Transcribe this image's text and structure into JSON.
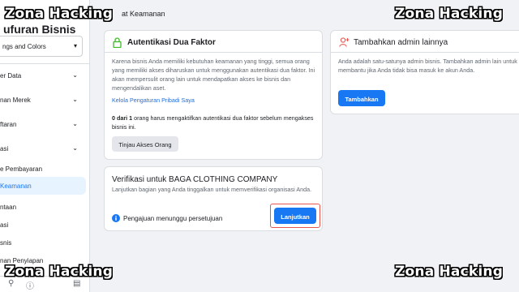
{
  "sidebar": {
    "title": "ufuran Bisnis",
    "selected_business": "ngs and Colors",
    "items": [
      {
        "label": "er Data",
        "chevron": true
      },
      {
        "label": "nan Merek",
        "chevron": true
      },
      {
        "label": "ftaran",
        "chevron": true
      },
      {
        "label": "asi",
        "chevron": true
      },
      {
        "label": "e Pembayaran",
        "chevron": false
      },
      {
        "label": "Keamanan",
        "chevron": false,
        "active": true
      },
      {
        "label": "ntaan",
        "chevron": false
      },
      {
        "label": "asi",
        "chevron": false
      },
      {
        "label": "snis",
        "chevron": false
      },
      {
        "label": "nan Penyiapan",
        "chevron": false
      }
    ],
    "footer_icons": [
      "search-icon",
      "info-icon",
      "notification-icon"
    ]
  },
  "header": {
    "title": "at Keamanan"
  },
  "two_factor": {
    "title": "Autentikasi Dua Faktor",
    "description": "Karena bisnis Anda memiliki kebutuhan keamanan yang tinggi, semua orang yang memiliki akses diharuskan untuk menggunakan autentikasi dua faktor. Ini akan mempersulit orang lain untuk mendapatkan akses ke bisnis dan mengendalikan aset.",
    "link": "Kelola Pengaturan Pribadi Saya",
    "count_bold": "0 dari 1",
    "count_rest": " orang harus mengaktifkan autentikasi dua faktor sebelum mengakses bisnis ini.",
    "button": "Tinjau Akses Orang"
  },
  "verification": {
    "title": "Verifikasi untuk BAGA CLOTHING COMPANY",
    "description": "Lanjutkan bagian yang Anda tinggalkan untuk memverifikasi organisasi Anda.",
    "status": "Pengajuan menunggu persetujuan",
    "button": "Lanjutkan"
  },
  "add_admin": {
    "title": "Tambahkan admin lainnya",
    "description": "Anda adalah satu-satunya admin bisnis. Tambahkan admin lain untuk membantu jika Anda tidak bisa masuk ke akun Anda.",
    "button": "Tambahkan"
  },
  "watermark": "Zona Hacking",
  "colors": {
    "accent": "#1877f2",
    "highlight": "#e8554e",
    "shield": "#42b72a"
  }
}
